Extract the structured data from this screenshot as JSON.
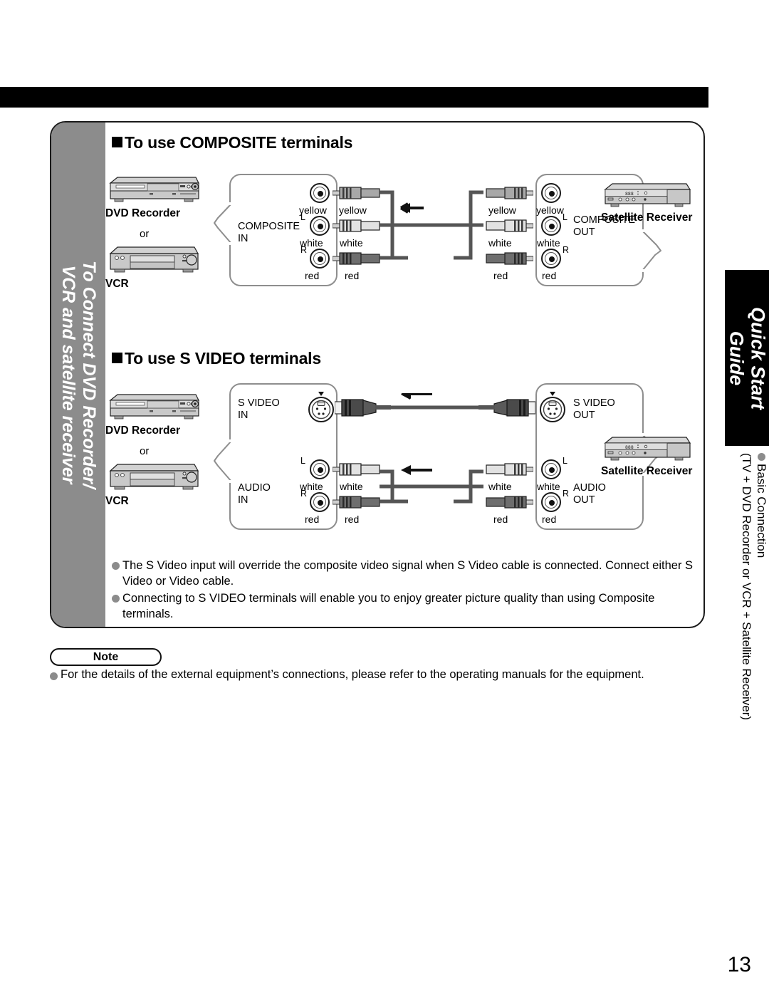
{
  "page": {
    "number": "13"
  },
  "side_tab": {
    "line1": "To Connect DVD Recorder/",
    "line2": "VCR and satellite receiver"
  },
  "quick_start_tab": {
    "line1": "Quick Start",
    "line2": "Guide"
  },
  "side_note": {
    "line1": "Basic Connection",
    "line2": "(TV + DVD Recorder or VCR + Satellite Receiver)"
  },
  "sections": [
    {
      "id": "composite",
      "heading": "To use COMPOSITE terminals",
      "source": {
        "device1": "DVD Recorder",
        "or": "or",
        "device2": "VCR"
      },
      "left_balloon": {
        "label_line1": "COMPOSITE",
        "label_line2": "IN",
        "jacks": [
          {
            "lr": "",
            "color": "yellow"
          },
          {
            "lr": "L",
            "color": "white"
          },
          {
            "lr": "R",
            "color": "red"
          }
        ]
      },
      "left_plugs": [
        "yellow",
        "white",
        "red"
      ],
      "right_plugs": [
        "yellow",
        "white",
        "red"
      ],
      "right_balloon": {
        "label_line1": "COMPOSITE",
        "label_line2": "OUT",
        "jacks": [
          {
            "lr": "",
            "color": "yellow"
          },
          {
            "lr": "L",
            "color": "white"
          },
          {
            "lr": "R",
            "color": "red"
          }
        ]
      },
      "destination": "Satellite Receiver"
    },
    {
      "id": "svideo",
      "heading": "To use S VIDEO terminals",
      "source": {
        "device1": "DVD Recorder",
        "or": "or",
        "device2": "VCR"
      },
      "left_balloon": {
        "video_label_line1": "S VIDEO",
        "video_label_line2": "IN",
        "audio_label_line1": "AUDIO",
        "audio_label_line2": "IN",
        "jacks": [
          {
            "lr": "L",
            "color": "white"
          },
          {
            "lr": "R",
            "color": "red"
          }
        ]
      },
      "left_plugs": [
        "white",
        "red"
      ],
      "right_plugs": [
        "white",
        "red"
      ],
      "right_balloon": {
        "video_label_line1": "S VIDEO",
        "video_label_line2": "OUT",
        "audio_label_line1": "AUDIO",
        "audio_label_line2": "OUT",
        "jacks": [
          {
            "lr": "L",
            "color": "white"
          },
          {
            "lr": "R",
            "color": "red"
          }
        ]
      },
      "destination": "Satellite Receiver"
    }
  ],
  "bullets": [
    "The S Video input will override the composite video signal when S Video cable is connected. Connect either S Video or Video cable.",
    "Connecting to S VIDEO terminals will enable you to enjoy greater picture quality than using Composite terminals."
  ],
  "note": {
    "title": "Note",
    "text": "For the details of the external equipment’s connections, please refer to the operating manuals for the equipment."
  },
  "colors": {
    "sidebar_gray": "#8c8c8c",
    "plug_yellow": "#a8a8a8",
    "plug_white": "#e2e2e2",
    "plug_red": "#6e6e6e",
    "wire": "#555555",
    "balloon_border": "#8e8e8e"
  }
}
